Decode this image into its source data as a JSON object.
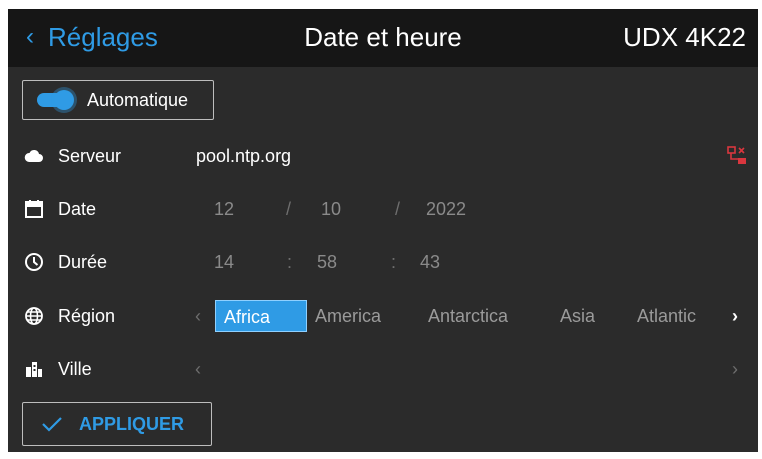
{
  "header": {
    "back_chevron": "‹",
    "back_label": "Réglages",
    "title": "Date et heure",
    "device": "UDX 4K22"
  },
  "auto": {
    "label": "Automatique",
    "enabled": true
  },
  "server": {
    "label": "Serveur",
    "value": "pool.ntp.org",
    "icon": "network-error-icon",
    "icon_color": "#d9363e"
  },
  "date": {
    "label": "Date",
    "day": "12",
    "month": "10",
    "year": "2022",
    "sep": "/"
  },
  "duration": {
    "label": "Durée",
    "hours": "14",
    "minutes": "58",
    "seconds": "43",
    "sep": ":"
  },
  "region": {
    "label": "Région",
    "prev": "‹",
    "next": "›",
    "options": [
      "Africa",
      "America",
      "Antarctica",
      "Asia",
      "Atlantic"
    ],
    "selected": "Africa"
  },
  "city": {
    "label": "Ville",
    "prev": "‹",
    "next": "›"
  },
  "apply": {
    "label": "APPLIQUER"
  },
  "colors": {
    "accent": "#2f9be5",
    "background": "#2b2b2b",
    "header": "#161616"
  }
}
